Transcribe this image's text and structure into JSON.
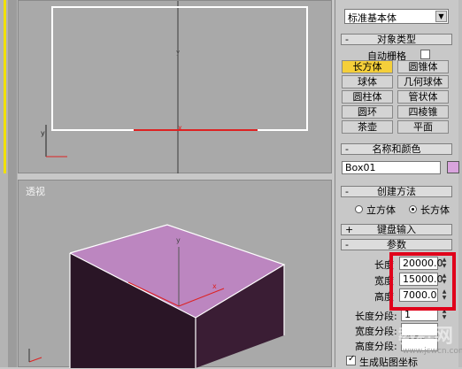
{
  "viewports": {
    "top": {
      "label": ""
    },
    "perspective": {
      "label": "透视"
    },
    "axis_y": "y",
    "axis_x": "x"
  },
  "panel": {
    "dropdown_value": "标准基本体",
    "object_type": {
      "title": "对象类型",
      "autogrid_label": "自动栅格",
      "buttons": [
        "长方体",
        "圆锥体",
        "球体",
        "几何球体",
        "圆柱体",
        "管状体",
        "圆环",
        "四棱锥",
        "茶壶",
        "平面"
      ],
      "active": "长方体"
    },
    "name_color": {
      "title": "名称和颜色",
      "name_value": "Box01",
      "color": "#d9a4dd"
    },
    "creation_method": {
      "title": "创建方法",
      "option_cube": "立方体",
      "option_box": "长方体",
      "selected": "长方体"
    },
    "keyboard_entry": {
      "title": "键盘输入"
    },
    "parameters": {
      "title": "参数",
      "length_label": "长度",
      "length_value": "20000.0",
      "width_label": "宽度",
      "width_value": "15000.0",
      "height_label": "高度",
      "height_value": "7000.0",
      "length_segs_label": "长度分段:",
      "length_segs_value": "1",
      "width_segs_label": "宽度分段:",
      "height_segs_label": "高度分段:",
      "gen_map_label": "生成贴图坐标"
    }
  },
  "colors": {
    "highlight": "#e0001a",
    "box_top": "#bc86c0",
    "box_side": "#2a1526",
    "active_button": "#f5cf3a",
    "grid_axis": "#d22"
  },
  "watermark": "www.jcwcn.com"
}
